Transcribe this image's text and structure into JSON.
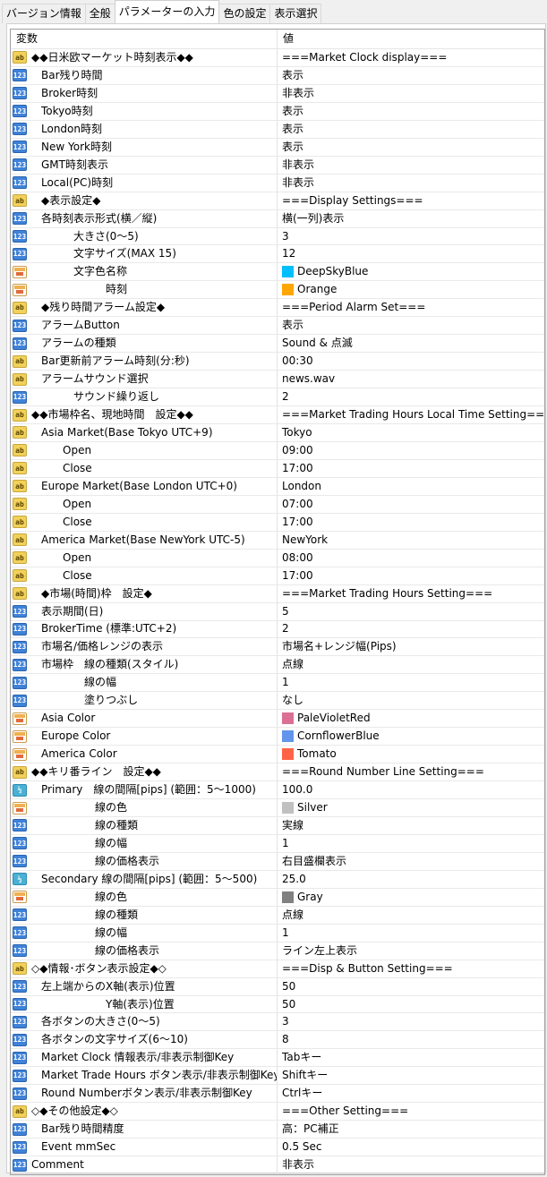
{
  "tabs": [
    {
      "label": "バージョン情報",
      "active": false
    },
    {
      "label": "全般",
      "active": false
    },
    {
      "label": "パラメーターの入力",
      "active": true
    },
    {
      "label": "色の設定",
      "active": false
    },
    {
      "label": "表示選択",
      "active": false
    }
  ],
  "table": {
    "header_var": "変数",
    "header_val": "値",
    "rows": [
      {
        "type": "str",
        "indent": 0,
        "name": "◆◆日米欧マーケット時刻表示◆◆",
        "value": "===Market Clock display==="
      },
      {
        "type": "int",
        "indent": 1,
        "name": "Bar残り時間",
        "value": "表示"
      },
      {
        "type": "int",
        "indent": 1,
        "name": "Broker時刻",
        "value": "非表示"
      },
      {
        "type": "int",
        "indent": 1,
        "name": "Tokyo時刻",
        "value": "表示"
      },
      {
        "type": "int",
        "indent": 1,
        "name": "London時刻",
        "value": "表示"
      },
      {
        "type": "int",
        "indent": 1,
        "name": "New York時刻",
        "value": "表示"
      },
      {
        "type": "int",
        "indent": 1,
        "name": "GMT時刻表示",
        "value": "非表示"
      },
      {
        "type": "int",
        "indent": 1,
        "name": "Local(PC)時刻",
        "value": "非表示"
      },
      {
        "type": "str",
        "indent": 1,
        "name": "◆表示設定◆",
        "value": "===Display Settings==="
      },
      {
        "type": "int",
        "indent": 1,
        "name": "各時刻表示形式(横／縦)",
        "value": "横(一列)表示"
      },
      {
        "type": "int",
        "indent": 4,
        "name": "大きさ(0～5)",
        "value": "3"
      },
      {
        "type": "int",
        "indent": 4,
        "name": "文字サイズ(MAX 15)",
        "value": "12"
      },
      {
        "type": "col",
        "indent": 4,
        "name": "文字色名称",
        "value": "DeepSkyBlue",
        "color": "#00bfff"
      },
      {
        "type": "col",
        "indent": 7,
        "name": "時刻",
        "value": "Orange",
        "color": "#ffa500"
      },
      {
        "type": "str",
        "indent": 1,
        "name": "◆残り時間アラーム設定◆",
        "value": "===Period Alarm Set==="
      },
      {
        "type": "int",
        "indent": 1,
        "name": "アラームButton",
        "value": "表示"
      },
      {
        "type": "int",
        "indent": 1,
        "name": "アラームの種類",
        "value": "Sound & 点滅"
      },
      {
        "type": "str",
        "indent": 1,
        "name": "Bar更新前アラーム時刻(分:秒)",
        "value": "00:30"
      },
      {
        "type": "str",
        "indent": 1,
        "name": "アラームサウンド選択",
        "value": "news.wav"
      },
      {
        "type": "int",
        "indent": 4,
        "name": "サウンド繰り返し",
        "value": "2"
      },
      {
        "type": "str",
        "indent": 0,
        "name": "◆◆市場枠名、現地時間　設定◆◆",
        "value": "===Market Trading Hours Local Time Setting==="
      },
      {
        "type": "str",
        "indent": 1,
        "name": "Asia Market(Base Tokyo UTC+9)",
        "value": "Tokyo"
      },
      {
        "type": "str",
        "indent": 3,
        "name": "Open",
        "value": "09:00"
      },
      {
        "type": "str",
        "indent": 3,
        "name": "Close",
        "value": "17:00"
      },
      {
        "type": "str",
        "indent": 1,
        "name": "Europe Market(Base London UTC+0)",
        "value": "London"
      },
      {
        "type": "str",
        "indent": 3,
        "name": "Open",
        "value": "07:00"
      },
      {
        "type": "str",
        "indent": 3,
        "name": "Close",
        "value": "17:00"
      },
      {
        "type": "str",
        "indent": 1,
        "name": "America Market(Base NewYork UTC-5)",
        "value": "NewYork"
      },
      {
        "type": "str",
        "indent": 3,
        "name": "Open",
        "value": "08:00"
      },
      {
        "type": "str",
        "indent": 3,
        "name": "Close",
        "value": "17:00"
      },
      {
        "type": "str",
        "indent": 1,
        "name": "◆市場(時間)枠　設定◆",
        "value": "===Market Trading Hours Setting==="
      },
      {
        "type": "int",
        "indent": 1,
        "name": "表示期間(日)",
        "value": "5"
      },
      {
        "type": "int",
        "indent": 1,
        "name": "BrokerTime (標準:UTC+2)",
        "value": "2"
      },
      {
        "type": "int",
        "indent": 1,
        "name": "市場名/価格レンジの表示",
        "value": "市場名+レンジ幅(Pips)"
      },
      {
        "type": "int",
        "indent": 1,
        "name": "市場枠　線の種類(スタイル)",
        "value": "点線"
      },
      {
        "type": "int",
        "indent": 5,
        "name": "線の幅",
        "value": "1"
      },
      {
        "type": "int",
        "indent": 5,
        "name": "塗りつぶし",
        "value": "なし"
      },
      {
        "type": "col",
        "indent": 1,
        "name": "Asia Color",
        "value": "PaleVioletRed",
        "color": "#db7093"
      },
      {
        "type": "col",
        "indent": 1,
        "name": "Europe Color",
        "value": "CornflowerBlue",
        "color": "#6495ed"
      },
      {
        "type": "col",
        "indent": 1,
        "name": "America Color",
        "value": "Tomato",
        "color": "#ff6347"
      },
      {
        "type": "str",
        "indent": 0,
        "name": "◆◆キリ番ライン　設定◆◆",
        "value": "===Round Number Line Setting==="
      },
      {
        "type": "dbl",
        "indent": 1,
        "name": "Primary　線の間隔[pips] (範囲：5～1000)",
        "value": "100.0"
      },
      {
        "type": "col",
        "indent": 6,
        "name": "線の色",
        "value": "Silver",
        "color": "#c0c0c0"
      },
      {
        "type": "int",
        "indent": 6,
        "name": "線の種類",
        "value": "実線"
      },
      {
        "type": "int",
        "indent": 6,
        "name": "線の幅",
        "value": "1"
      },
      {
        "type": "int",
        "indent": 6,
        "name": "線の価格表示",
        "value": "右目盛欄表示"
      },
      {
        "type": "dbl",
        "indent": 1,
        "name": "Secondary 線の間隔[pips] (範囲：5～500)",
        "value": "25.0"
      },
      {
        "type": "col",
        "indent": 6,
        "name": "線の色",
        "value": "Gray",
        "color": "#808080"
      },
      {
        "type": "int",
        "indent": 6,
        "name": "線の種類",
        "value": "点線"
      },
      {
        "type": "int",
        "indent": 6,
        "name": "線の幅",
        "value": "1"
      },
      {
        "type": "int",
        "indent": 6,
        "name": "線の価格表示",
        "value": "ライン左上表示"
      },
      {
        "type": "str",
        "indent": 0,
        "name": "◇◆情報･ボタン表示設定◆◇",
        "value": "===Disp & Button Setting==="
      },
      {
        "type": "int",
        "indent": 1,
        "name": "左上端からのX軸(表示)位置",
        "value": "50"
      },
      {
        "type": "int",
        "indent": 7,
        "name": "Y軸(表示)位置",
        "value": "50"
      },
      {
        "type": "int",
        "indent": 1,
        "name": "各ボタンの大きさ(0～5)",
        "value": "3"
      },
      {
        "type": "int",
        "indent": 1,
        "name": "各ボタンの文字サイズ(6～10)",
        "value": "8"
      },
      {
        "type": "int",
        "indent": 1,
        "name": "Market Clock 情報表示/非表示制御Key",
        "value": "Tabキー"
      },
      {
        "type": "int",
        "indent": 1,
        "name": "Market Trade Hours ボタン表示/非表示制御Key",
        "value": "Shiftキー"
      },
      {
        "type": "int",
        "indent": 1,
        "name": "Round Numberボタン表示/非表示制御Key",
        "value": "Ctrlキー"
      },
      {
        "type": "str",
        "indent": 0,
        "name": "◇◆その他設定◆◇",
        "value": "===Other Setting==="
      },
      {
        "type": "int",
        "indent": 1,
        "name": "Bar残り時間精度",
        "value": "高：PC補正"
      },
      {
        "type": "int",
        "indent": 1,
        "name": "Event mmSec",
        "value": "0.5 Sec"
      },
      {
        "type": "int",
        "indent": 0,
        "name": "Comment",
        "value": "非表示"
      }
    ]
  },
  "icons": {
    "int": "123",
    "str": "ab",
    "dbl": "½"
  }
}
